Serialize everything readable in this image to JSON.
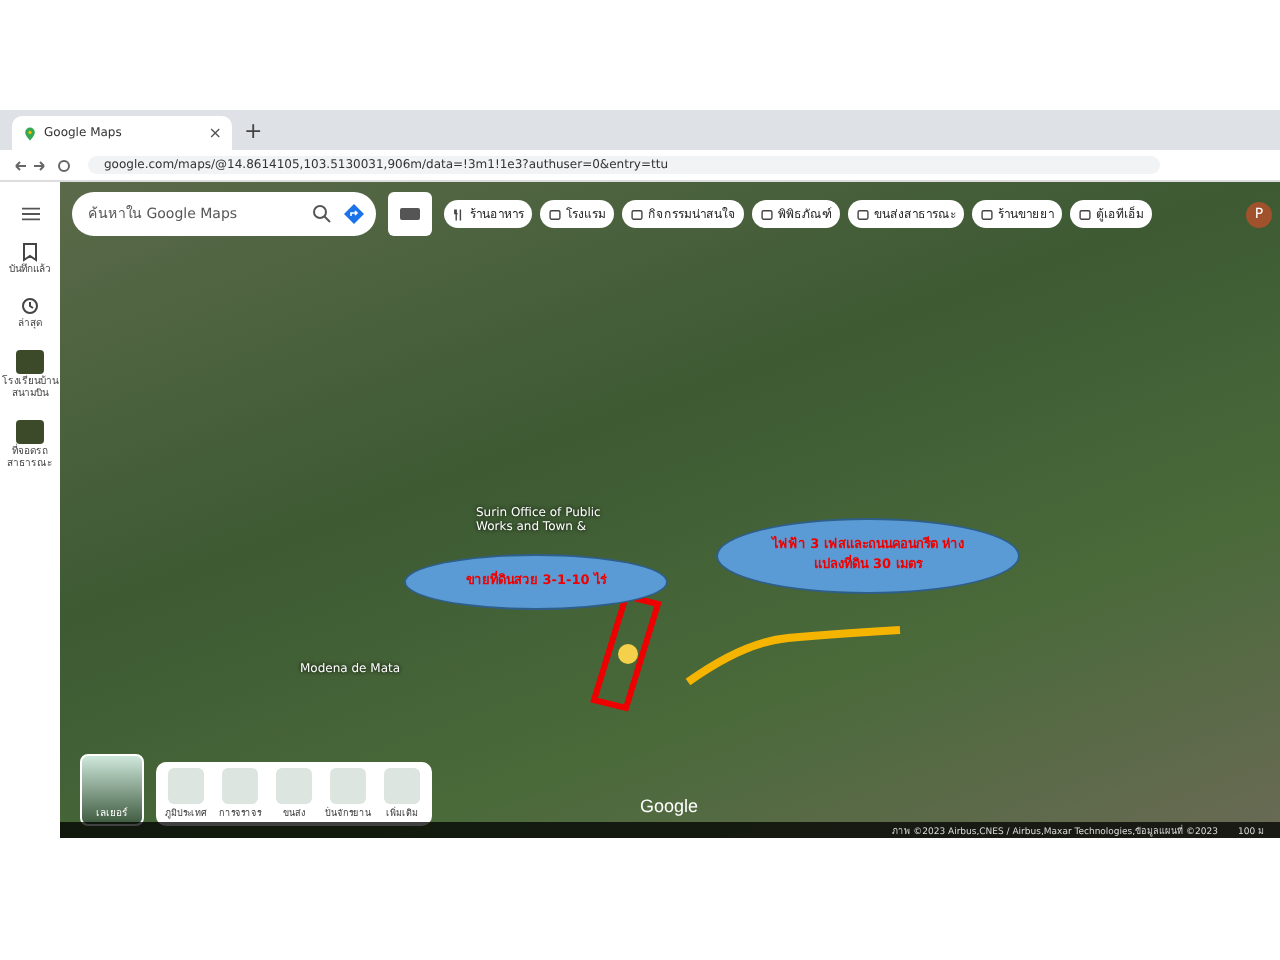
{
  "browser": {
    "tab_title": "Google Maps",
    "tab_close": "×",
    "new_tab": "+",
    "url": "google.com/maps/@14.8614105,103.5130031,906m/data=!3m1!1e3?authuser=0&entry=ttu"
  },
  "sidebar": {
    "items": [
      {
        "label": "บันทึกแล้ว",
        "kind": "bookmark"
      },
      {
        "label": "ล่าสุด",
        "kind": "history"
      },
      {
        "label": "โรงเรียนบ้านสนามบิน",
        "kind": "thumb"
      },
      {
        "label": "ที่จอดรถสาธารณะ",
        "kind": "thumb"
      }
    ]
  },
  "search": {
    "placeholder": "ค้นหาใน Google Maps"
  },
  "chips": [
    {
      "label": "ร้านอาหาร",
      "kind": "food"
    },
    {
      "label": "โรงแรม",
      "kind": "hotel"
    },
    {
      "label": "กิจกรรมน่าสนใจ",
      "kind": "camera"
    },
    {
      "label": "พิพิธภัณฑ์",
      "kind": "museum"
    },
    {
      "label": "ขนส่งสาธารณะ",
      "kind": "transit"
    },
    {
      "label": "ร้านขายยา",
      "kind": "pharmacy"
    },
    {
      "label": "ตู้เอทีเอ็ม",
      "kind": "atm"
    }
  ],
  "account": {
    "initial": "P"
  },
  "map": {
    "labels": [
      "Surin Office of Public Works and Town &",
      "Modena de Mata"
    ],
    "callouts": [
      "ขายที่ดินสวย 3-1-10 ไร่",
      "ไฟฟ้า 3 เฟสและถนนคอนกรีต ห่างแปลงที่ดิน 30 เมตร"
    ],
    "logo": "Google",
    "attribution": "ภาพ ©2023 Airbus,CNES / Airbus,Maxar Technologies,ข้อมูลแผนที่ ©2023",
    "scale": "100 ม"
  },
  "layers": {
    "label": "เลเยอร์",
    "options": [
      "ภูมิประเทศ",
      "การจราจร",
      "ขนส่ง",
      "ปั่นจักรยาน",
      "เพิ่มเติม"
    ]
  }
}
